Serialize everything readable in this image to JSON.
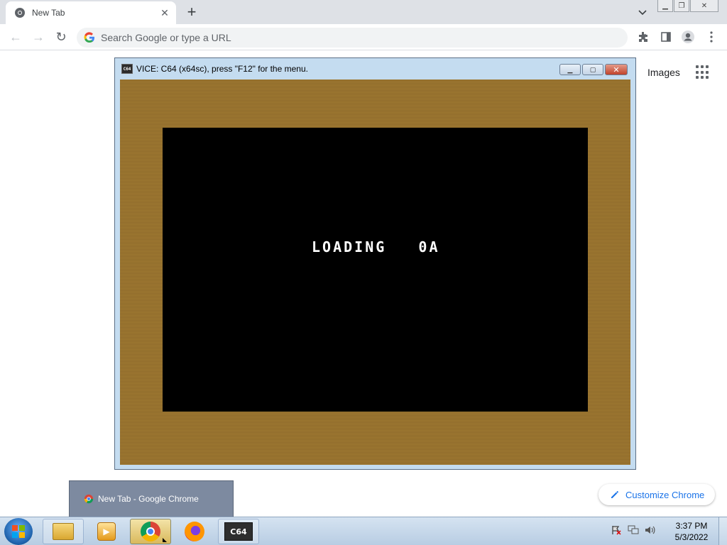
{
  "browser": {
    "tab": {
      "title": "New Tab"
    },
    "omnibox": {
      "placeholder": "Search Google or type a URL"
    }
  },
  "ntp": {
    "images_link": "Images",
    "customize_label": "Customize Chrome"
  },
  "vice": {
    "title": "VICE: C64 (x64sc), press \"F12\" for the menu.",
    "icon_text": "C64",
    "screen_text": "LOADING   0A",
    "colors": {
      "border": "#a07a33",
      "screen": "#000000",
      "text": "#ffffff"
    }
  },
  "taskbar": {
    "thumbnail_label": "New Tab - Google Chrome",
    "c64_label": "C64",
    "clock_time": "3:37 PM",
    "clock_date": "5/3/2022"
  }
}
